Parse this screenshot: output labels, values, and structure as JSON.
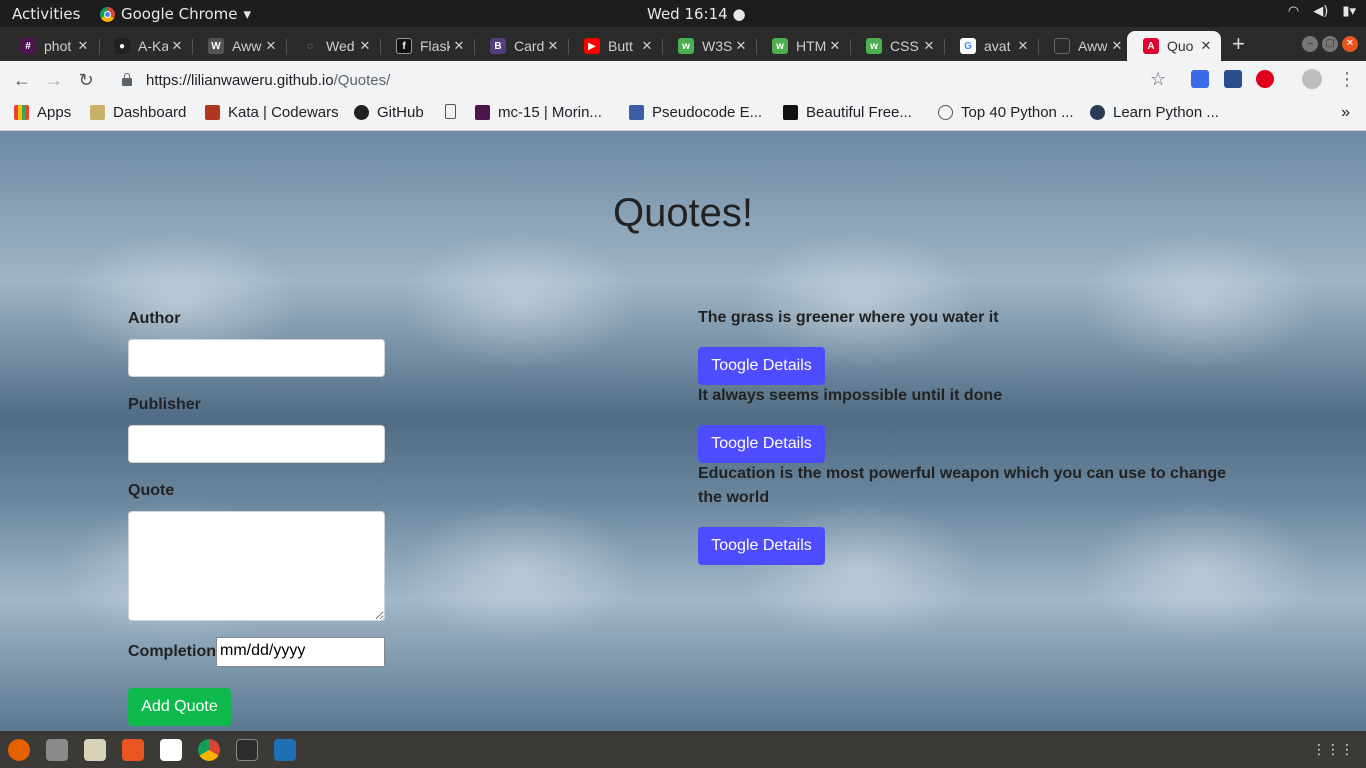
{
  "system": {
    "activities": "Activities",
    "app_name": "Google Chrome",
    "clock": "Wed 16:14"
  },
  "tabs": [
    {
      "title": "phot",
      "icon": "slack-icon",
      "color": "#4a154b"
    },
    {
      "title": "A-Ka",
      "icon": "github-icon",
      "color": "#222222"
    },
    {
      "title": "Aww",
      "icon": "w-icon",
      "color": "#555555"
    },
    {
      "title": "Wed",
      "icon": "loader-icon",
      "color": "#2b2b2b"
    },
    {
      "title": "Flask",
      "icon": "flask-icon",
      "color": "#111111"
    },
    {
      "title": "Card",
      "icon": "bootstrap-icon",
      "color": "#563d7c"
    },
    {
      "title": "Butt",
      "icon": "youtube-icon",
      "color": "#ff0000"
    },
    {
      "title": "W3S",
      "icon": "w3schools-icon",
      "color": "#4caf50"
    },
    {
      "title": "HTM",
      "icon": "w3schools-icon",
      "color": "#4caf50"
    },
    {
      "title": "CSS",
      "icon": "w3schools-icon",
      "color": "#4caf50"
    },
    {
      "title": "avat",
      "icon": "google-icon",
      "color": "#ffffff"
    },
    {
      "title": "Aww",
      "icon": "page-icon",
      "color": "#3a3a3a"
    },
    {
      "title": "Quo",
      "icon": "angular-icon",
      "color": "#dd0031"
    }
  ],
  "address": {
    "host": "https://lilianwaweru.github.io",
    "path": "/Quotes/"
  },
  "bookmarks": [
    {
      "label": "Apps",
      "icon": "apps-grid-icon"
    },
    {
      "label": "Dashboard",
      "icon": "dashboard-icon"
    },
    {
      "label": "Kata | Codewars",
      "icon": "codewars-icon"
    },
    {
      "label": "GitHub",
      "icon": "github-icon"
    },
    {
      "label": "",
      "icon": "page-icon"
    },
    {
      "label": "mc-15 | Morin...",
      "icon": "slack-icon"
    },
    {
      "label": "Pseudocode E...",
      "icon": "bird-icon"
    },
    {
      "label": "Beautiful Free...",
      "icon": "unsplash-icon"
    },
    {
      "label": "Top 40 Python ...",
      "icon": "guru-icon"
    },
    {
      "label": "Learn Python ...",
      "icon": "python-icon"
    }
  ],
  "page": {
    "title": "Quotes!",
    "form": {
      "author_label": "Author",
      "publisher_label": "Publisher",
      "quote_label": "Quote",
      "completion_label": "Completion",
      "date_placeholder": "mm/dd/yyyy",
      "submit_label": "Add Quote"
    },
    "quotes": [
      {
        "text": "The grass is greener where you water it",
        "button": "Toogle Details"
      },
      {
        "text": "It always seems impossible until it done",
        "button": "Toogle Details"
      },
      {
        "text": "Education is the most powerful weapon which you can use to change the world",
        "button": "Toogle Details"
      }
    ]
  },
  "colors": {
    "add_button": "#0dba4b",
    "toggle_button": "#4e4cff"
  }
}
